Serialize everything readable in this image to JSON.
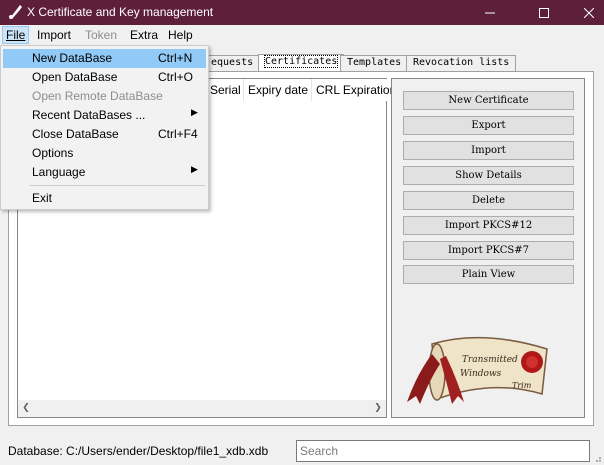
{
  "window": {
    "title": "X Certificate and Key management",
    "controls": {
      "minimize": "minimize",
      "maximize": "maximize",
      "close": "close"
    }
  },
  "menubar": {
    "items": [
      {
        "label": "File",
        "state": "open"
      },
      {
        "label": "Import",
        "state": "normal"
      },
      {
        "label": "Token",
        "state": "disabled"
      },
      {
        "label": "Extra",
        "state": "normal"
      },
      {
        "label": "Help",
        "state": "normal"
      }
    ]
  },
  "file_menu": {
    "items": [
      {
        "label": "New DataBase",
        "shortcut": "Ctrl+N",
        "state": "highlighted"
      },
      {
        "label": "Open DataBase",
        "shortcut": "Ctrl+O",
        "state": "normal"
      },
      {
        "label": "Open Remote DataBase",
        "shortcut": "",
        "state": "disabled"
      },
      {
        "label": "Recent DataBases ...",
        "shortcut": "",
        "state": "submenu"
      },
      {
        "label": "Close DataBase",
        "shortcut": "Ctrl+F4",
        "state": "normal"
      },
      {
        "label": "Options",
        "shortcut": "",
        "state": "normal"
      },
      {
        "label": "Language",
        "shortcut": "",
        "state": "submenu"
      },
      {
        "label": "Exit",
        "shortcut": "",
        "state": "normal"
      }
    ]
  },
  "tabs": [
    {
      "label": "equests",
      "selected": false
    },
    {
      "label": "Certificates",
      "selected": true
    },
    {
      "label": "Templates",
      "selected": false
    },
    {
      "label": "Revocation lists",
      "selected": false
    }
  ],
  "tree": {
    "columns": [
      "Serial",
      "Expiry date",
      "CRL Expiration"
    ]
  },
  "buttons": [
    {
      "label": "New Certificate"
    },
    {
      "label": "Export"
    },
    {
      "label": "Import"
    },
    {
      "label": "Show Details"
    },
    {
      "label": "Delete"
    },
    {
      "label": "Import PKCS#12"
    },
    {
      "label": "Import PKCS#7"
    },
    {
      "label": "Plain View"
    }
  ],
  "seal_text": "Transmitted Windows Trim",
  "status": {
    "database": "Database: C:/Users/ender/Desktop/file1_xdb.xdb"
  },
  "search": {
    "placeholder": "Search",
    "value": ""
  },
  "colors": {
    "titlebar": "#5e1f3c",
    "menu_highlight": "#91c9f7",
    "window_bg": "#f0f0f0"
  }
}
